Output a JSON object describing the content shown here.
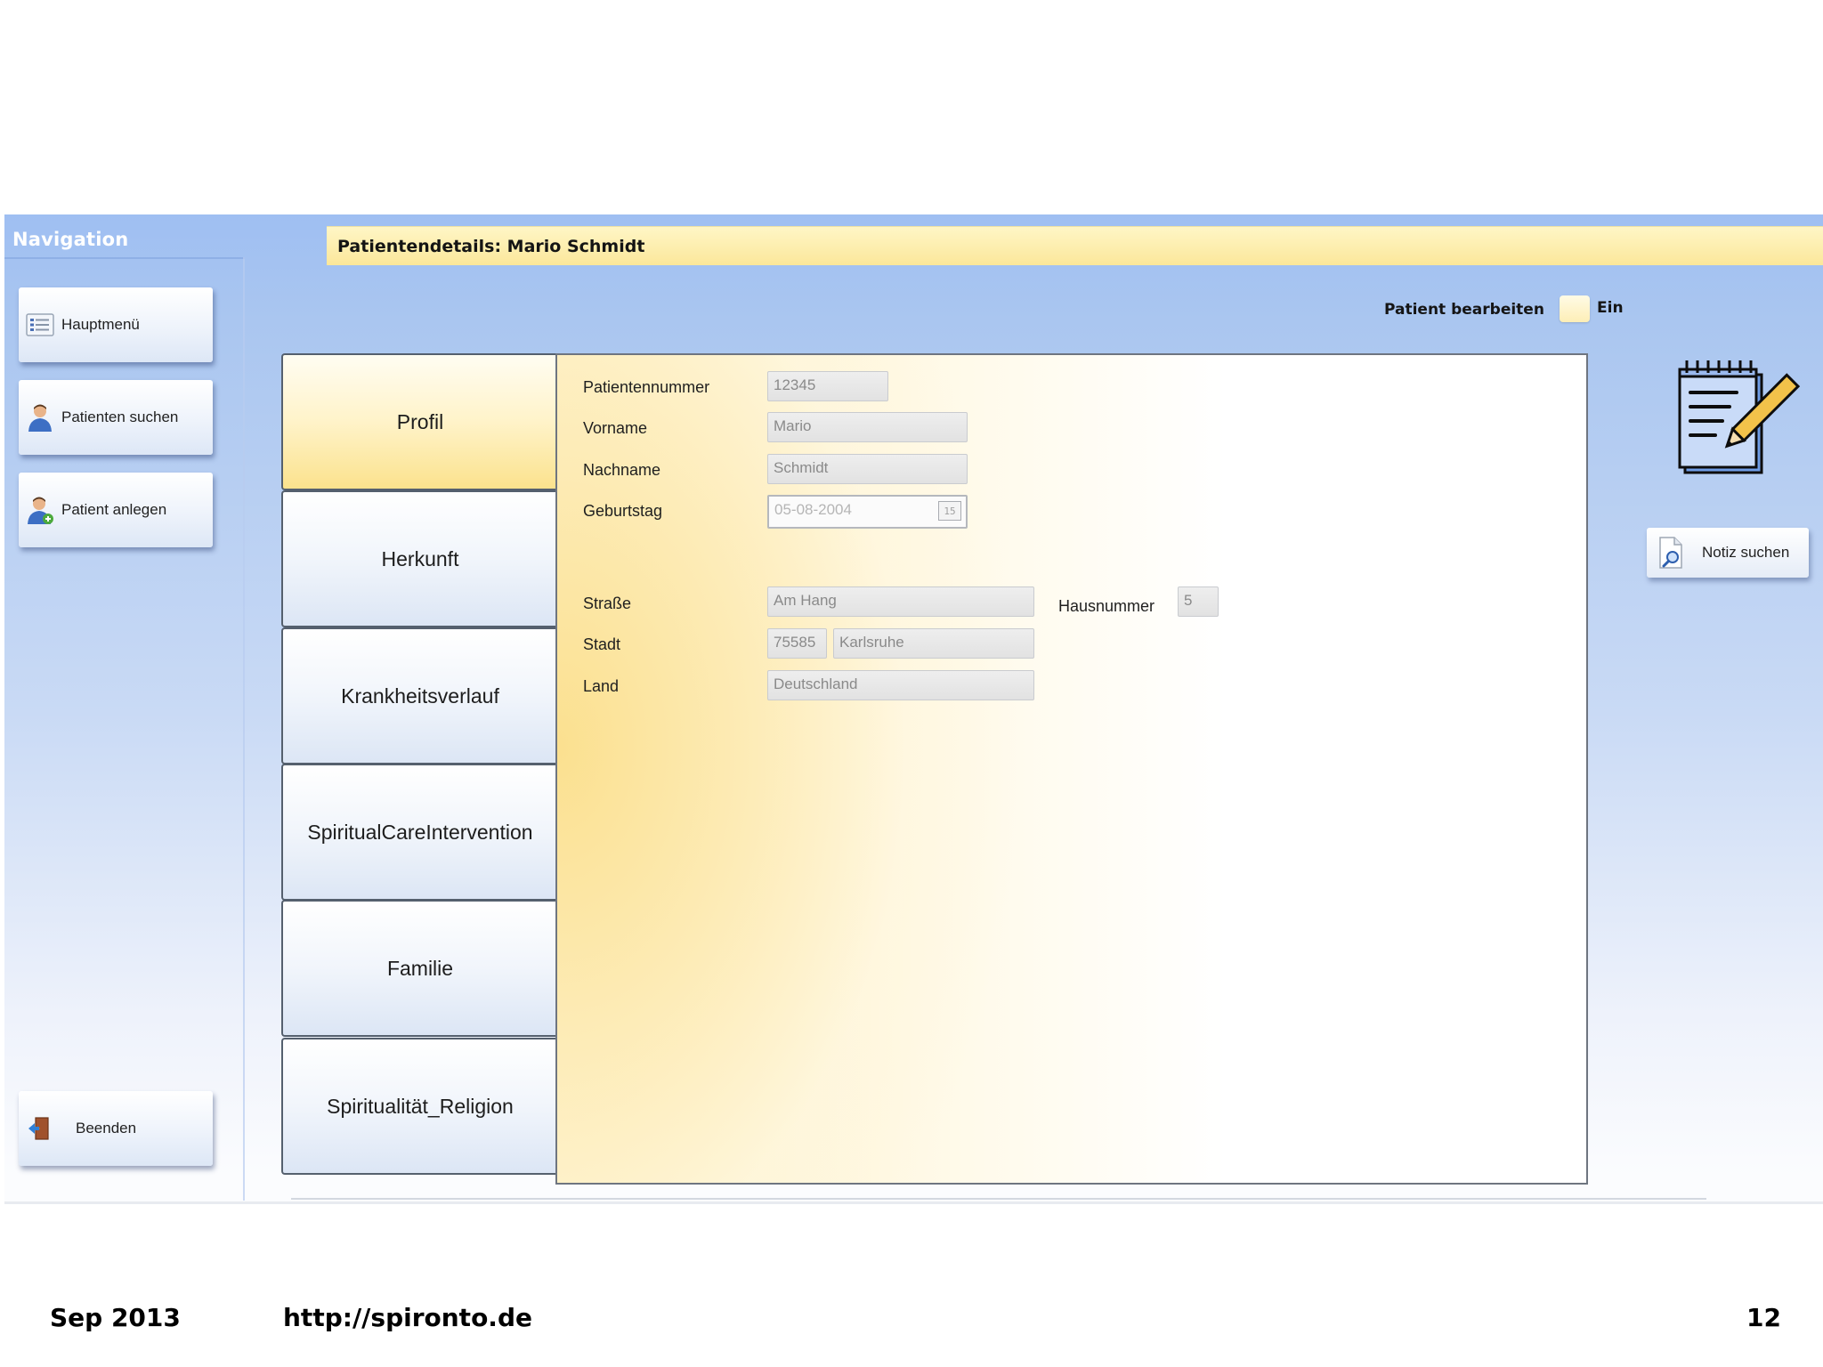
{
  "navigation": {
    "title": "Navigation",
    "items": [
      {
        "label": "Hauptmenü",
        "icon": "list-icon"
      },
      {
        "label": "Patienten suchen",
        "icon": "user-search-icon"
      },
      {
        "label": "Patient anlegen",
        "icon": "user-add-icon"
      }
    ],
    "exit_label": "Beenden",
    "exit_icon": "exit-door-icon"
  },
  "header": {
    "title": "Patientendetails: Mario Schmidt"
  },
  "edit_mode": {
    "label": "Patient bearbeiten",
    "state_label": "Ein"
  },
  "tabs": [
    {
      "label": "Profil",
      "active": true
    },
    {
      "label": "Herkunft",
      "active": false
    },
    {
      "label": "Krankheitsverlauf",
      "active": false
    },
    {
      "label": "SpiritualCareIntervention",
      "active": false
    },
    {
      "label": "Familie",
      "active": false
    },
    {
      "label": "Spiritualität_Religion",
      "active": false
    }
  ],
  "form": {
    "patient_number": {
      "label": "Patientennummer",
      "value": "12345"
    },
    "first_name": {
      "label": "Vorname",
      "value": "Mario"
    },
    "last_name": {
      "label": "Nachname",
      "value": "Schmidt"
    },
    "birthday": {
      "label": "Geburtstag",
      "value": "05-08-2004",
      "calendar_day": "15"
    },
    "street": {
      "label": "Straße",
      "value": "Am Hang"
    },
    "house_number": {
      "label": "Hausnummer",
      "value": "5"
    },
    "city": {
      "label": "Stadt",
      "zip": "75585",
      "value": "Karlsruhe"
    },
    "country": {
      "label": "Land",
      "value": "Deutschland"
    }
  },
  "notes": {
    "icon": "notepad-pencil-icon",
    "search_label": "Notiz suchen",
    "search_icon": "document-search-icon"
  },
  "slide_footer": {
    "date": "Sep 2013",
    "url": "http://spironto.de",
    "page": "12"
  },
  "colors": {
    "nav_blue": "#9fbff2",
    "header_yellow": "#fbe79a",
    "active_tab_yellow": "#fbe28d"
  }
}
